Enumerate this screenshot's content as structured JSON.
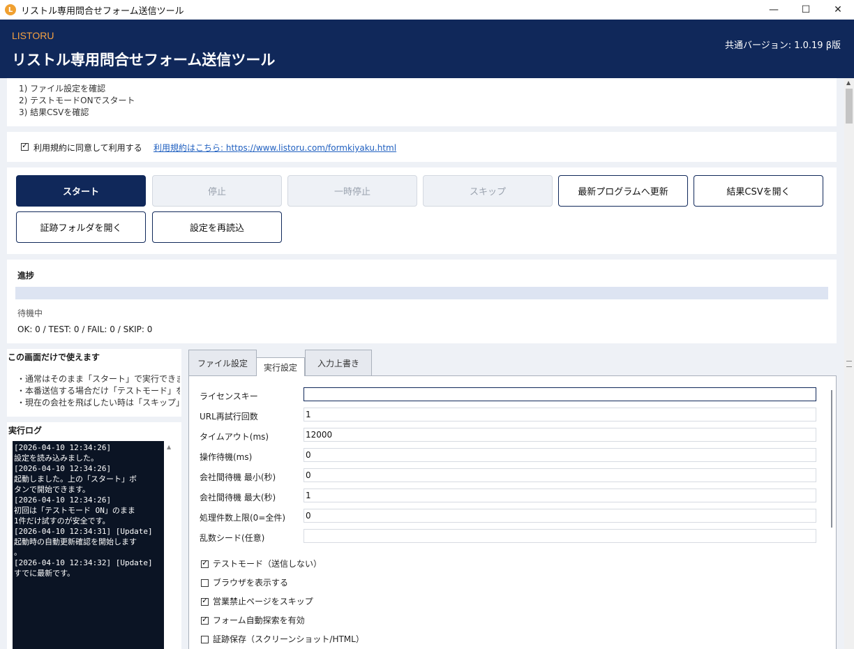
{
  "window": {
    "title": "リストル専用問合せフォーム送信ツール",
    "app_icon_glyph": "L",
    "controls": {
      "minimize": "—",
      "maximize": "☐",
      "close": "✕"
    }
  },
  "header": {
    "brand": "LISTORU",
    "title": "リストル専用問合せフォーム送信ツール",
    "version": "共通バージョン: 1.0.19 β版"
  },
  "steps": [
    "1) ファイル設定を確認",
    "2) テストモードONでスタート",
    "3) 結果CSVを確認"
  ],
  "agree": {
    "checked": true,
    "label": "利用規約に同意して利用する",
    "link": "利用規約はこちら: https://www.listoru.com/formkiyaku.html"
  },
  "buttons": {
    "start": "スタート",
    "stop": "停止",
    "pause": "一時停止",
    "skip": "スキップ",
    "update": "最新プログラムへ更新",
    "open_csv": "結果CSVを開く",
    "open_evidence": "証跡フォルダを開く",
    "reload": "設定を再読込"
  },
  "progress": {
    "label": "進捗",
    "value": 0,
    "status": "待機中",
    "counts": "OK: 0 / TEST: 0 / FAIL: 0 / SKIP: 0"
  },
  "info": {
    "title": "この画面だけで使えます",
    "lines": [
      "・通常はそのまま「スタート」で実行できます",
      "・本番送信する場合だけ「テストモード」をOF",
      "・現在の会社を飛ばしたい時は「スキップ」ボ"
    ]
  },
  "log": {
    "title": "実行ログ",
    "lines": [
      "[2026-04-10 12:34:26]",
      "設定を読み込みました。",
      "[2026-04-10 12:34:26]",
      "起動しました。上の「スタート」ボ",
      "タンで開始できます。",
      "[2026-04-10 12:34:26]",
      "初回は「テストモード ON」のまま",
      "1件だけ試すのが安全です。",
      "[2026-04-10 12:34:31] [Update]",
      "起動時の自動更新確認を開始します",
      "。",
      "[2026-04-10 12:34:32] [Update]",
      "すでに最新です。"
    ]
  },
  "tabs": [
    "ファイル設定",
    "実行設定",
    "入力上書き"
  ],
  "settings": {
    "fields": [
      {
        "label": "ライセンスキー",
        "value": ""
      },
      {
        "label": "URL再試行回数",
        "value": "1"
      },
      {
        "label": "タイムアウト(ms)",
        "value": "12000"
      },
      {
        "label": "操作待機(ms)",
        "value": "0"
      },
      {
        "label": "会社間待機 最小(秒)",
        "value": "0"
      },
      {
        "label": "会社間待機 最大(秒)",
        "value": "1"
      },
      {
        "label": "処理件数上限(0=全件)",
        "value": "0"
      },
      {
        "label": "乱数シード(任意)",
        "value": ""
      }
    ],
    "options": [
      {
        "label": "テストモード（送信しない）",
        "checked": true
      },
      {
        "label": "ブラウザを表示する",
        "checked": false
      },
      {
        "label": "営業禁止ページをスキップ",
        "checked": true
      },
      {
        "label": "フォーム自動探索を有効",
        "checked": true
      },
      {
        "label": "証跡保存（スクリーンショット/HTML）",
        "checked": false
      }
    ]
  },
  "colors": {
    "header_bg": "#10285a",
    "brand_accent": "#f5a142",
    "link": "#2060c0",
    "log_bg": "#0b1424"
  }
}
